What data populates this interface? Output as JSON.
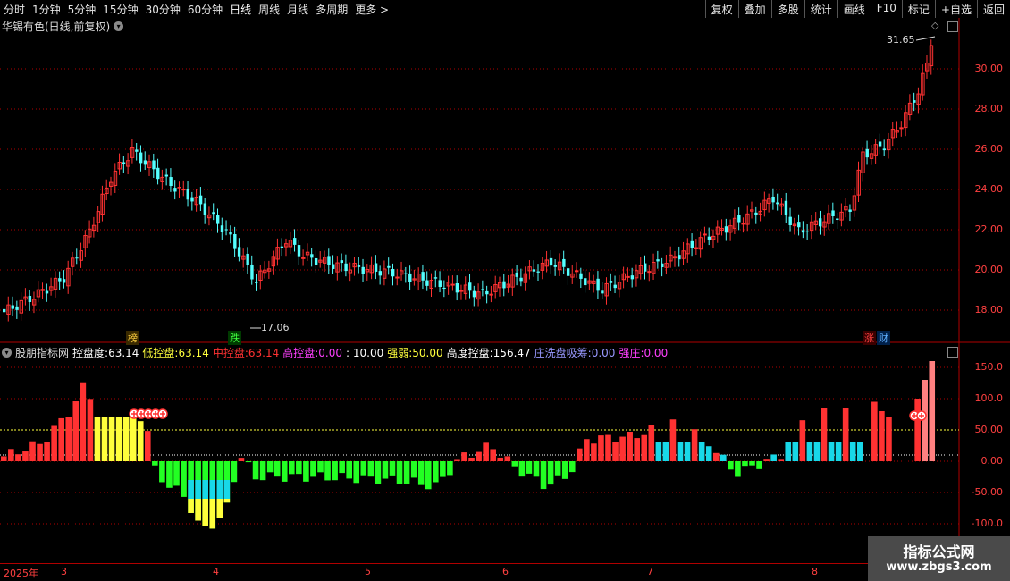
{
  "toolbar": {
    "periods": [
      "分时",
      "1分钟",
      "5分钟",
      "15分钟",
      "30分钟",
      "60分钟",
      "日线",
      "周线",
      "月线",
      "多周期",
      "更多 >"
    ],
    "right_buttons": [
      "复权",
      "叠加",
      "多股",
      "统计",
      "画线",
      "F10",
      "标记",
      "+自选",
      "返回"
    ]
  },
  "stock": {
    "title": "华锡有色(日线,前复权)"
  },
  "price_axis": [
    "30.00",
    "28.00",
    "26.00",
    "24.00",
    "22.00",
    "20.00",
    "18.00"
  ],
  "price_marks": {
    "high": "31.65",
    "low": "17.06"
  },
  "tags": {
    "bang": "榜",
    "die": "跌",
    "zhang": "涨",
    "cai": "财"
  },
  "indicator": {
    "name": "股朋指标网",
    "kongpandu_label": "控盘度:",
    "kongpandu_value": "63.14",
    "dikongpan_label": "低控盘:",
    "dikongpan_value": "63.14",
    "zhongkongpan_label": "中控盘:",
    "zhongkongpan_value": "63.14",
    "gaokongpan_label": "高控盘:",
    "gaokongpan_value": "0.00",
    "sep": ": 10.00",
    "qiangruo_label": "强弱:",
    "qiangruo_value": "50.00",
    "gaodu_label": "高度控盘:",
    "gaodu_value": "156.47",
    "xichou_label": "庄洗盘吸筹:",
    "xichou_value": "0.00",
    "qiangzhuang_label": "强庄:",
    "qiangzhuang_value": "0.00"
  },
  "indicator_axis": [
    "150.0",
    "100.0",
    "50.00",
    "0.00",
    "-50.00",
    "-100.0"
  ],
  "dates": [
    "2025年",
    "3",
    "4",
    "5",
    "6",
    "7",
    "8"
  ],
  "logo": {
    "title": "指标公式网",
    "url": "www.zbgs3.com"
  },
  "colors": {
    "up": "#ff3232",
    "down": "#54ffff",
    "dotted": "#b00000",
    "yellow": "#ffff3c",
    "green": "#23ff23",
    "cyan": "#18d8e8",
    "purple": "#9898d0"
  }
}
